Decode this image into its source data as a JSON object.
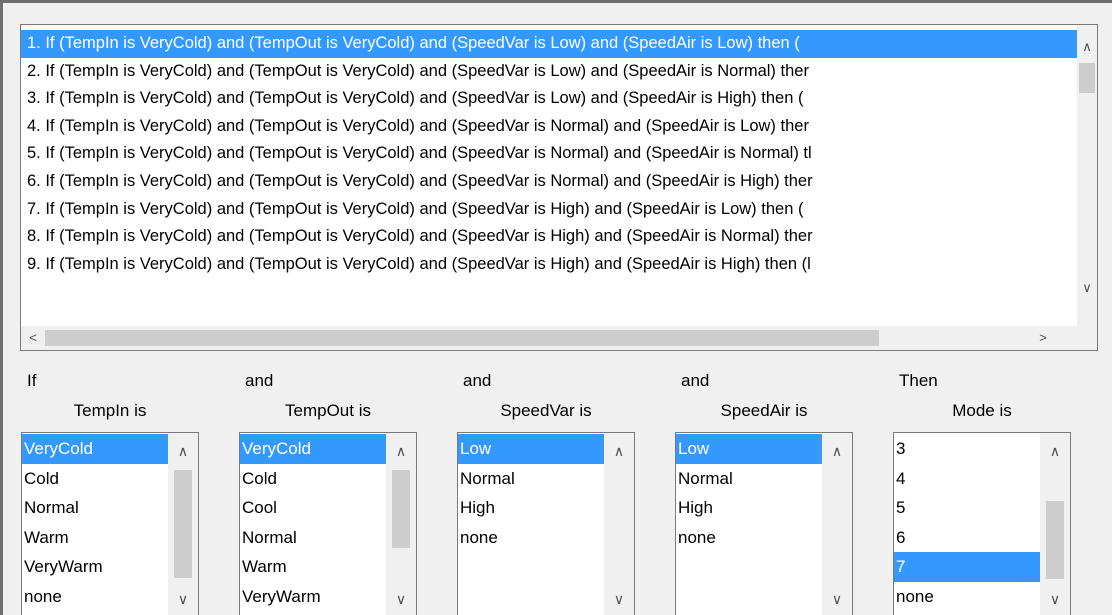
{
  "rules": [
    "1. If (TempIn is VeryCold) and (TempOut is VeryCold) and (SpeedVar is Low) and (SpeedAir is Low) then (",
    "2. If (TempIn is VeryCold) and (TempOut is VeryCold) and (SpeedVar is Low) and (SpeedAir is Normal) ther",
    "3. If (TempIn is VeryCold) and (TempOut is VeryCold) and (SpeedVar is Low) and (SpeedAir is High) then (",
    "4. If (TempIn is VeryCold) and (TempOut is VeryCold) and (SpeedVar is Normal) and (SpeedAir is Low) ther",
    "5. If (TempIn is VeryCold) and (TempOut is VeryCold) and (SpeedVar is Normal) and (SpeedAir is Normal) tl",
    "6. If (TempIn is VeryCold) and (TempOut is VeryCold) and (SpeedVar is Normal) and (SpeedAir is High) ther",
    "7. If (TempIn is VeryCold) and (TempOut is VeryCold) and (SpeedVar is High) and (SpeedAir is Low) then (",
    "8. If (TempIn is VeryCold) and (TempOut is VeryCold) and (SpeedVar is High) and (SpeedAir is Normal) ther",
    "9. If (TempIn is VeryCold) and (TempOut is VeryCold) and (SpeedVar is High) and (SpeedAir is High) then (l"
  ],
  "selected_rule": 0,
  "columns": [
    {
      "connector": "If",
      "title": "TempIn is",
      "items": [
        "VeryCold",
        "Cold",
        "Normal",
        "Warm",
        "VeryWarm",
        "none"
      ],
      "selected": 0
    },
    {
      "connector": "and",
      "title": "TempOut is",
      "items": [
        "VeryCold",
        "Cold",
        "Cool",
        "Normal",
        "Warm",
        "VeryWarm"
      ],
      "selected": 0
    },
    {
      "connector": "and",
      "title": "SpeedVar is",
      "items": [
        "Low",
        "Normal",
        "High",
        "none"
      ],
      "selected": 0
    },
    {
      "connector": "and",
      "title": "SpeedAir is",
      "items": [
        "Low",
        "Normal",
        "High",
        "none"
      ],
      "selected": 0
    },
    {
      "connector": "Then",
      "title": "Mode is",
      "items": [
        "3",
        "4",
        "5",
        "6",
        "7",
        "none"
      ],
      "selected": 4
    }
  ],
  "colors": {
    "selection": "#3399ff",
    "background": "#f0f0f0",
    "scroll_thumb": "#cdcdcd"
  },
  "icons": {
    "up": "chevron-up-icon",
    "down": "chevron-down-icon",
    "left": "chevron-left-icon",
    "right": "chevron-right-icon"
  }
}
